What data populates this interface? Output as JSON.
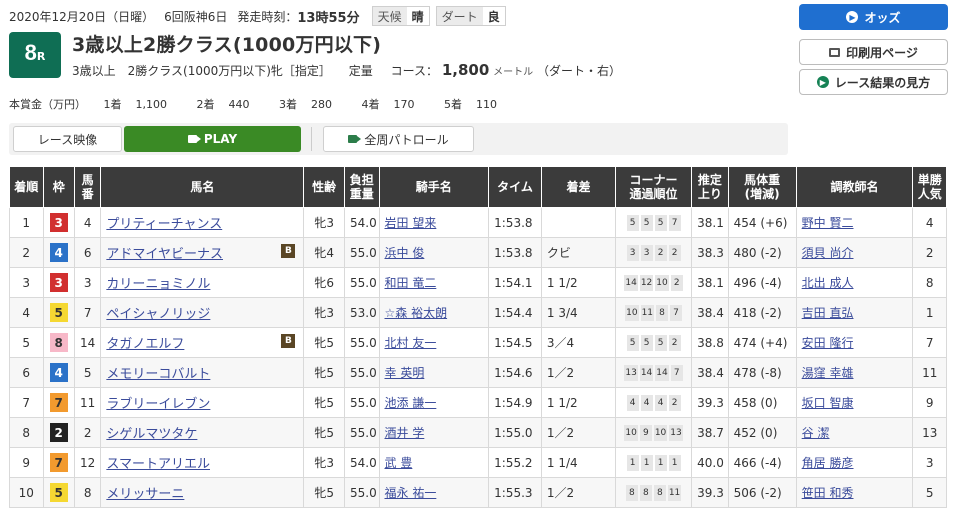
{
  "header": {
    "date": "2020年12月20日（日曜）",
    "meeting": "6回阪神6日",
    "start_label": "発走時刻：",
    "start_time": "13時55分",
    "weather_label": "天候",
    "weather": "晴",
    "track_label": "ダート",
    "track_condition": "良"
  },
  "race": {
    "number": "8",
    "number_suffix": "R",
    "title": "3歳以上2勝クラス(1000万円以下)",
    "conditions": "3歳以上　2勝クラス(1000万円以下)牝［指定］",
    "weight_rule": "定量",
    "course_label": "コース：",
    "distance": "1,800",
    "distance_unit": "メートル",
    "course_detail": "（ダート・右）"
  },
  "prize": {
    "label": "本賞金（万円）",
    "items": [
      {
        "place": "1着",
        "amount": "1,100"
      },
      {
        "place": "2着",
        "amount": "440"
      },
      {
        "place": "3着",
        "amount": "280"
      },
      {
        "place": "4着",
        "amount": "170"
      },
      {
        "place": "5着",
        "amount": "110"
      }
    ]
  },
  "buttons": {
    "odds": "オッズ",
    "print": "印刷用ページ",
    "guide": "レース結果の見方"
  },
  "video": {
    "label": "レース映像",
    "play": "PLAY",
    "patrol": "全周パトロール"
  },
  "colors": {
    "race_badge": "#0f6e54",
    "header_bg": "#3b3b3b",
    "link": "#3a4b9b",
    "odds_button": "#1f6fd0",
    "play_button": "#3a8a25",
    "waku": {
      "2": {
        "bg": "#222222",
        "fg": "#ffffff"
      },
      "3": {
        "bg": "#d12f2f",
        "fg": "#ffffff"
      },
      "4": {
        "bg": "#2b72c8",
        "fg": "#ffffff"
      },
      "5": {
        "bg": "#f5d832",
        "fg": "#333333"
      },
      "7": {
        "bg": "#f29a2e",
        "fg": "#333333"
      },
      "8": {
        "bg": "#f7b8c8",
        "fg": "#333333"
      }
    }
  },
  "table": {
    "headers": [
      {
        "key": "rank",
        "l1": "着順",
        "l2": ""
      },
      {
        "key": "waku",
        "l1": "枠",
        "l2": ""
      },
      {
        "key": "num",
        "l1": "馬",
        "l2": "番"
      },
      {
        "key": "horse",
        "l1": "馬名",
        "l2": ""
      },
      {
        "key": "sexage",
        "l1": "性齢",
        "l2": ""
      },
      {
        "key": "weight",
        "l1": "負担",
        "l2": "重量"
      },
      {
        "key": "jockey",
        "l1": "騎手名",
        "l2": ""
      },
      {
        "key": "time",
        "l1": "タイム",
        "l2": ""
      },
      {
        "key": "margin",
        "l1": "着差",
        "l2": ""
      },
      {
        "key": "corner",
        "l1": "コーナー",
        "l2": "通過順位"
      },
      {
        "key": "last3f",
        "l1": "推定",
        "l2": "上り"
      },
      {
        "key": "bodyweight",
        "l1": "馬体重",
        "l2": "(増減)"
      },
      {
        "key": "trainer",
        "l1": "調教師名",
        "l2": ""
      },
      {
        "key": "pop",
        "l1": "単勝",
        "l2": "人気"
      }
    ],
    "rows": [
      {
        "rank": "1",
        "waku": "3",
        "num": "4",
        "horse": "プリティーチャンス",
        "blinker": "",
        "sexage": "牝3",
        "weight": "54.0",
        "jockey": "岩田 望来",
        "time": "1:53.8",
        "margin": "",
        "corner": [
          "5",
          "5",
          "5",
          "7"
        ],
        "last3f": "38.1",
        "bodyweight": "454 (+6)",
        "trainer": "野中 賢二",
        "pop": "4"
      },
      {
        "rank": "2",
        "waku": "4",
        "num": "6",
        "horse": "アドマイヤビーナス",
        "blinker": "B",
        "sexage": "牝4",
        "weight": "55.0",
        "jockey": "浜中 俊",
        "time": "1:53.8",
        "margin": "クビ",
        "corner": [
          "3",
          "3",
          "2",
          "2"
        ],
        "last3f": "38.3",
        "bodyweight": "480 (-2)",
        "trainer": "須貝 尚介",
        "pop": "2"
      },
      {
        "rank": "3",
        "waku": "3",
        "num": "3",
        "horse": "カリーニョミノル",
        "blinker": "",
        "sexage": "牝6",
        "weight": "55.0",
        "jockey": "和田 竜二",
        "time": "1:54.1",
        "margin": "1 1/2",
        "corner": [
          "14",
          "12",
          "10",
          "2"
        ],
        "last3f": "38.1",
        "bodyweight": "496 (-4)",
        "trainer": "北出 成人",
        "pop": "8"
      },
      {
        "rank": "4",
        "waku": "5",
        "num": "7",
        "horse": "ペイシャノリッジ",
        "blinker": "",
        "sexage": "牝3",
        "weight": "53.0",
        "jockey": "☆森 裕太朗",
        "time": "1:54.4",
        "margin": "1 3/4",
        "corner": [
          "10",
          "11",
          "8",
          "7"
        ],
        "last3f": "38.4",
        "bodyweight": "418 (-2)",
        "trainer": "吉田 直弘",
        "pop": "1"
      },
      {
        "rank": "5",
        "waku": "8",
        "num": "14",
        "horse": "タガノエルフ",
        "blinker": "B",
        "sexage": "牝5",
        "weight": "55.0",
        "jockey": "北村 友一",
        "time": "1:54.5",
        "margin": "3／4",
        "corner": [
          "5",
          "5",
          "5",
          "2"
        ],
        "last3f": "38.8",
        "bodyweight": "474 (+4)",
        "trainer": "安田 隆行",
        "pop": "7"
      },
      {
        "rank": "6",
        "waku": "4",
        "num": "5",
        "horse": "メモリーコバルト",
        "blinker": "",
        "sexage": "牝5",
        "weight": "55.0",
        "jockey": "幸 英明",
        "time": "1:54.6",
        "margin": "1／2",
        "corner": [
          "13",
          "14",
          "14",
          "7"
        ],
        "last3f": "38.4",
        "bodyweight": "478 (-8)",
        "trainer": "湯窪 幸雄",
        "pop": "11"
      },
      {
        "rank": "7",
        "waku": "7",
        "num": "11",
        "horse": "ラブリーイレブン",
        "blinker": "",
        "sexage": "牝5",
        "weight": "55.0",
        "jockey": "池添 謙一",
        "time": "1:54.9",
        "margin": "1 1/2",
        "corner": [
          "4",
          "4",
          "4",
          "2"
        ],
        "last3f": "39.3",
        "bodyweight": "458 (0)",
        "trainer": "坂口 智康",
        "pop": "9"
      },
      {
        "rank": "8",
        "waku": "2",
        "num": "2",
        "horse": "シゲルマツタケ",
        "blinker": "",
        "sexage": "牝5",
        "weight": "55.0",
        "jockey": "酒井 学",
        "time": "1:55.0",
        "margin": "1／2",
        "corner": [
          "10",
          "9",
          "10",
          "13"
        ],
        "last3f": "38.7",
        "bodyweight": "452 (0)",
        "trainer": "谷 潔",
        "pop": "13"
      },
      {
        "rank": "9",
        "waku": "7",
        "num": "12",
        "horse": "スマートアリエル",
        "blinker": "",
        "sexage": "牝3",
        "weight": "54.0",
        "jockey": "武 豊",
        "time": "1:55.2",
        "margin": "1 1/4",
        "corner": [
          "1",
          "1",
          "1",
          "1"
        ],
        "last3f": "40.0",
        "bodyweight": "466 (-4)",
        "trainer": "角居 勝彦",
        "pop": "3"
      },
      {
        "rank": "10",
        "waku": "5",
        "num": "8",
        "horse": "メリッサーニ",
        "blinker": "",
        "sexage": "牝5",
        "weight": "55.0",
        "jockey": "福永 祐一",
        "time": "1:55.3",
        "margin": "1／2",
        "corner": [
          "8",
          "8",
          "8",
          "11"
        ],
        "last3f": "39.3",
        "bodyweight": "506 (-2)",
        "trainer": "笹田 和秀",
        "pop": "5"
      }
    ]
  }
}
